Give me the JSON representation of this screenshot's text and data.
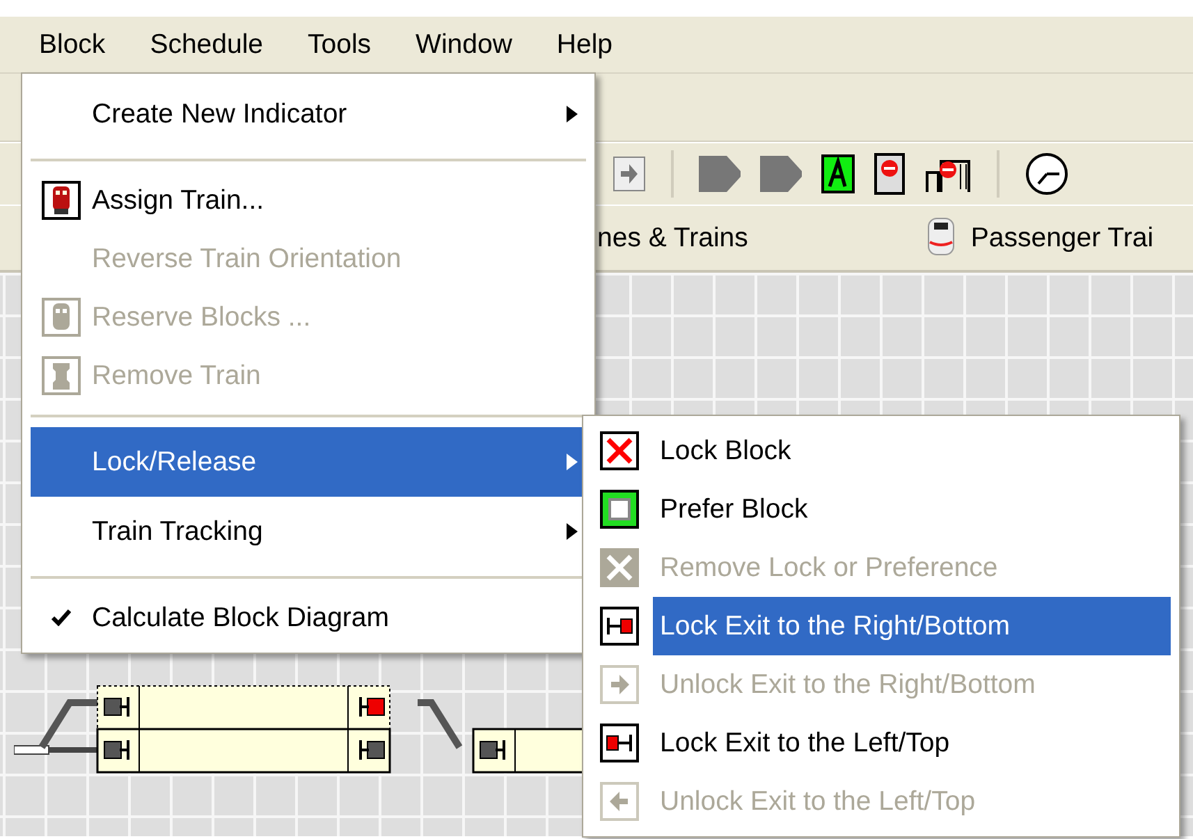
{
  "menubar": [
    {
      "label": "Block"
    },
    {
      "label": "Schedule"
    },
    {
      "label": "Tools"
    },
    {
      "label": "Window"
    },
    {
      "label": "Help"
    }
  ],
  "tabs": [
    {
      "label": "nes & Trains"
    },
    {
      "label": "Passenger Trai"
    }
  ],
  "menu": {
    "items": [
      {
        "kind": "submenu",
        "label": "Create New Indicator",
        "disabled": false,
        "selected": false
      },
      {
        "kind": "separator"
      },
      {
        "kind": "item",
        "label": "Assign Train...",
        "disabled": false,
        "selected": false
      },
      {
        "kind": "item",
        "label": "Reverse Train Orientation",
        "disabled": true,
        "selected": false
      },
      {
        "kind": "item",
        "label": "Reserve Blocks ...",
        "disabled": true,
        "selected": false
      },
      {
        "kind": "item",
        "label": "Remove Train",
        "disabled": true,
        "selected": false
      },
      {
        "kind": "separator"
      },
      {
        "kind": "submenu",
        "label": "Lock/Release",
        "disabled": false,
        "selected": true
      },
      {
        "kind": "submenu",
        "label": "Train Tracking",
        "disabled": false,
        "selected": false
      },
      {
        "kind": "separator"
      },
      {
        "kind": "check",
        "label": "Calculate Block Diagram",
        "disabled": false,
        "selected": false,
        "checked": true
      }
    ]
  },
  "submenu": {
    "items": [
      {
        "label": "Lock Block",
        "disabled": false,
        "selected": false
      },
      {
        "label": "Prefer Block",
        "disabled": false,
        "selected": false
      },
      {
        "label": "Remove Lock or Preference",
        "disabled": true,
        "selected": false
      },
      {
        "label": "Lock Exit to the Right/Bottom",
        "disabled": false,
        "selected": true
      },
      {
        "label": "Unlock Exit to the Right/Bottom",
        "disabled": true,
        "selected": false
      },
      {
        "label": "Lock Exit to the Left/Top",
        "disabled": false,
        "selected": false
      },
      {
        "label": "Unlock Exit to the Left/Top",
        "disabled": true,
        "selected": false
      }
    ]
  }
}
